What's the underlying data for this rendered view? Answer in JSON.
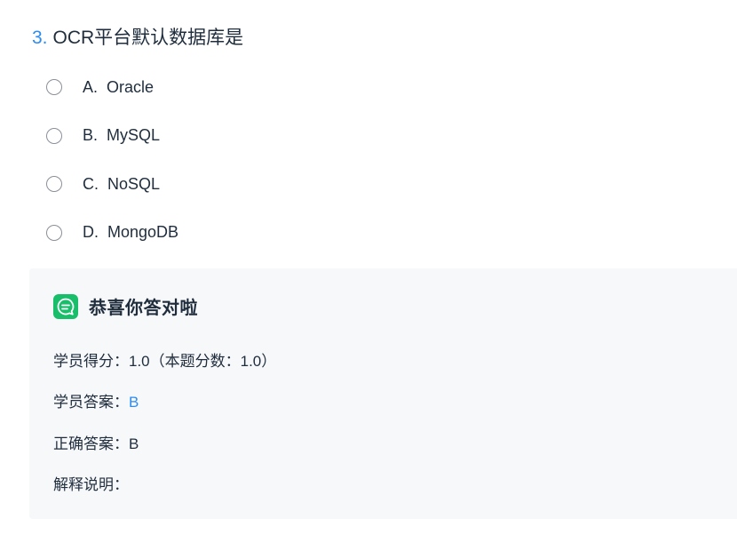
{
  "question": {
    "number": "3.",
    "text": "OCR平台默认数据库是"
  },
  "options": [
    {
      "key": "A.",
      "text": "Oracle"
    },
    {
      "key": "B.",
      "text": "MySQL"
    },
    {
      "key": "C.",
      "text": "NoSQL"
    },
    {
      "key": "D.",
      "text": "MongoDB"
    }
  ],
  "result": {
    "icon": "chat-bubble-icon",
    "title": "恭喜你答对啦",
    "score_label": "学员得分：",
    "score_value": "1.0（本题分数：1.0）",
    "student_answer_label": "学员答案：",
    "student_answer_value": "B",
    "correct_answer_label": "正确答案：",
    "correct_answer_value": "B",
    "explanation_label": "解释说明："
  },
  "colors": {
    "accent": "#2d8cf0",
    "success_icon": "#19be6b",
    "result_bg": "#f7f8fa",
    "text": "#1f2d3d"
  }
}
